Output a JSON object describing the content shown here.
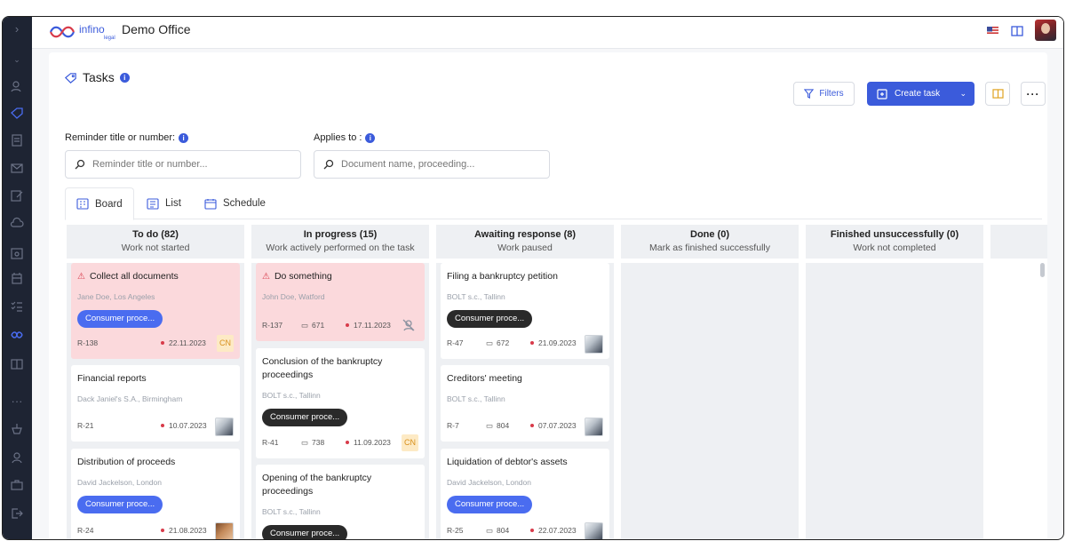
{
  "app": {
    "office": "Demo Office"
  },
  "page": {
    "title": "Tasks"
  },
  "toolbar": {
    "filters_label": "Filters",
    "create_label": "Create task"
  },
  "filters": {
    "reminder_label": "Reminder title or number:",
    "reminder_placeholder": "Reminder title or number...",
    "applies_label": "Applies to :",
    "applies_placeholder": "Document name, proceeding..."
  },
  "tabs": [
    {
      "label": "Board",
      "active": true
    },
    {
      "label": "List",
      "active": false
    },
    {
      "label": "Schedule",
      "active": false
    }
  ],
  "columns": [
    {
      "title": "To do (82)",
      "subtitle": "Work not started",
      "cards": [
        {
          "title": "Collect all documents",
          "alert": true,
          "sub": "Jane Doe, Los Angeles",
          "pill": "Consumer proce...",
          "pill_style": "blue",
          "id": "R-138",
          "pages": "",
          "date": "22.11.2023",
          "badge": "CN"
        },
        {
          "title": "Financial reports",
          "alert": false,
          "sub": "Dack Janiel's S.A., Birmingham",
          "pill": "",
          "id": "R-21",
          "pages": "",
          "date": "10.07.2023",
          "avatar": "man"
        },
        {
          "title": "Distribution of proceeds",
          "alert": false,
          "sub": "David Jackelson, London",
          "pill": "Consumer proce...",
          "pill_style": "blue",
          "id": "R-24",
          "pages": "",
          "date": "21.08.2023",
          "avatar": "woman"
        }
      ]
    },
    {
      "title": "In progress (15)",
      "subtitle": "Work actively performed on the task",
      "cards": [
        {
          "title": "Do something",
          "alert": true,
          "sub": "John Doe, Watford",
          "pill": "",
          "id": "R-137",
          "pages": "671",
          "date": "17.11.2023",
          "avatar": "none"
        },
        {
          "title": "Conclusion of the bankruptcy proceedings",
          "alert": false,
          "sub": "BOLT s.c., Tallinn",
          "pill": "Consumer proce...",
          "pill_style": "dark",
          "id": "R-41",
          "pages": "738",
          "date": "11.09.2023",
          "badge": "CN"
        },
        {
          "title": "Opening of the bankruptcy proceedings",
          "alert": false,
          "sub": "BOLT s.c., Tallinn",
          "pill": "Consumer proce...",
          "pill_style": "dark",
          "id": "",
          "pages": "",
          "date": ""
        }
      ]
    },
    {
      "title": "Awaiting response (8)",
      "subtitle": "Work paused",
      "cards": [
        {
          "title": "Filing a bankruptcy petition",
          "alert": false,
          "sub": "BOLT s.c., Tallinn",
          "pill": "Consumer proce...",
          "pill_style": "dark",
          "id": "R-47",
          "pages": "672",
          "date": "21.09.2023",
          "avatar": "man"
        },
        {
          "title": "Creditors' meeting",
          "alert": false,
          "sub": "BOLT s.c., Tallinn",
          "pill": "",
          "id": "R-7",
          "pages": "804",
          "date": "07.07.2023",
          "avatar": "man"
        },
        {
          "title": "Liquidation of debtor's assets",
          "alert": false,
          "sub": "David Jackelson, London",
          "pill": "Consumer proce...",
          "pill_style": "blue",
          "id": "R-25",
          "pages": "804",
          "date": "22.07.2023",
          "avatar": "man"
        }
      ]
    },
    {
      "title": "Done (0)",
      "subtitle": "Mark as finished successfully",
      "cards": []
    },
    {
      "title": "Finished unsuccessfully (0)",
      "subtitle": "Work not completed",
      "cards": []
    }
  ],
  "colors": {
    "accent": "#3b5bdb",
    "alert_bg": "#fbd9dc",
    "column_bg": "#eef0f3",
    "sidebar_bg": "#1e2433"
  }
}
